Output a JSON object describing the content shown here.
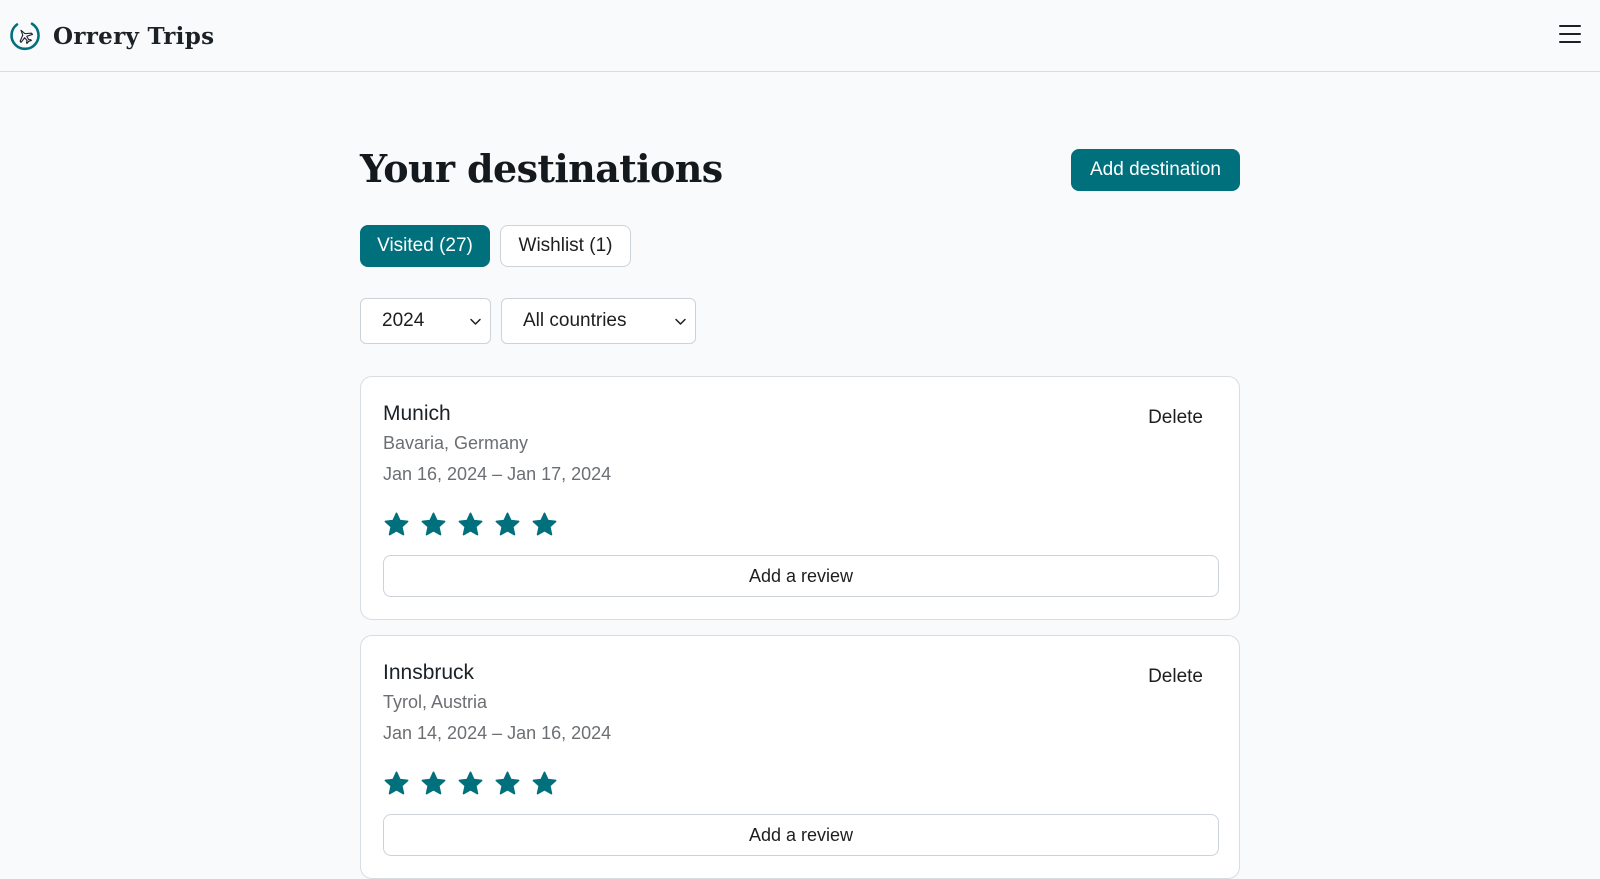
{
  "app": {
    "name": "Orrery Trips",
    "logo_icon": "plane-circle-icon",
    "menu_icon": "hamburger-menu-icon",
    "accent_color": "#00707c"
  },
  "page": {
    "title": "Your destinations",
    "add_button": "Add destination"
  },
  "tabs": [
    {
      "label": "Visited (27)",
      "active": true
    },
    {
      "label": "Wishlist (1)",
      "active": false
    }
  ],
  "filters": {
    "year": "2024",
    "country": "All countries"
  },
  "destinations": [
    {
      "city": "Munich",
      "region": "Bavaria, Germany",
      "dates": "Jan 16, 2024 – Jan 17, 2024",
      "rating": 5,
      "rating_max": 5,
      "delete_label": "Delete",
      "review_label": "Add a review"
    },
    {
      "city": "Innsbruck",
      "region": "Tyrol, Austria",
      "dates": "Jan 14, 2024 – Jan 16, 2024",
      "rating": 5,
      "rating_max": 5,
      "delete_label": "Delete",
      "review_label": "Add a review"
    }
  ]
}
